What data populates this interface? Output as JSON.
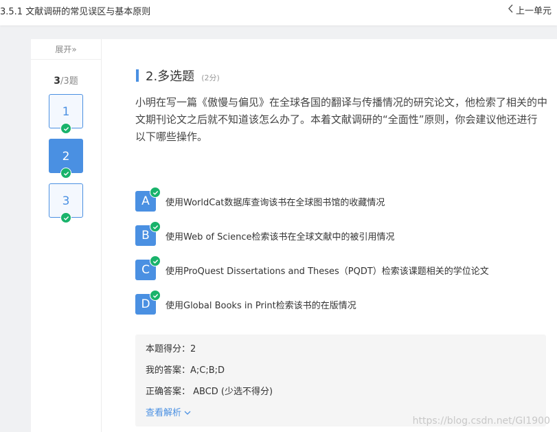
{
  "header": {
    "title": "3.5.1 文献调研的常见误区与基本原则",
    "prev_label": "上一单元"
  },
  "sidebar": {
    "expand_label": "展开»",
    "progress_current": "3",
    "progress_total": "/3题",
    "questions": [
      {
        "number": "1",
        "state": "answered"
      },
      {
        "number": "2",
        "state": "current"
      },
      {
        "number": "3",
        "state": "answered"
      }
    ]
  },
  "question": {
    "type_label": "2.多选题",
    "score_label": "(2分)",
    "stem": "小明在写一篇《傲慢与偏见》在全球各国的翻译与传播情况的研究论文，他检索了相关的中文期刊论文之后就不知道该怎么办了。本着文献调研的“全面性”原则，你会建议他还进行以下哪些操作。",
    "options": [
      {
        "letter": "A",
        "text": "使用WorldCat数据库查询该书在全球图书馆的收藏情况"
      },
      {
        "letter": "B",
        "text": "使用Web of Science检索该书在全球文献中的被引用情况"
      },
      {
        "letter": "C",
        "text": "使用ProQuest Dissertations and Theses（PQDT）检索该课题相关的学位论文"
      },
      {
        "letter": "D",
        "text": "使用Global Books in Print检索该书的在版情况"
      }
    ]
  },
  "result": {
    "score_line": "本题得分：2",
    "my_answer_line": "我的答案：A;C;B;D",
    "correct_answer_line": "正确答案：  ABCD (少选不得分)",
    "analysis_label": "查看解析"
  },
  "watermark": "https://blog.csdn.net/GI1900",
  "colors": {
    "accent": "#4a90e2",
    "success": "#19b36b"
  },
  "icons": {
    "prev": "chevron-left-icon",
    "check": "check-circle-icon",
    "analysis": "chevron-down-icon"
  }
}
